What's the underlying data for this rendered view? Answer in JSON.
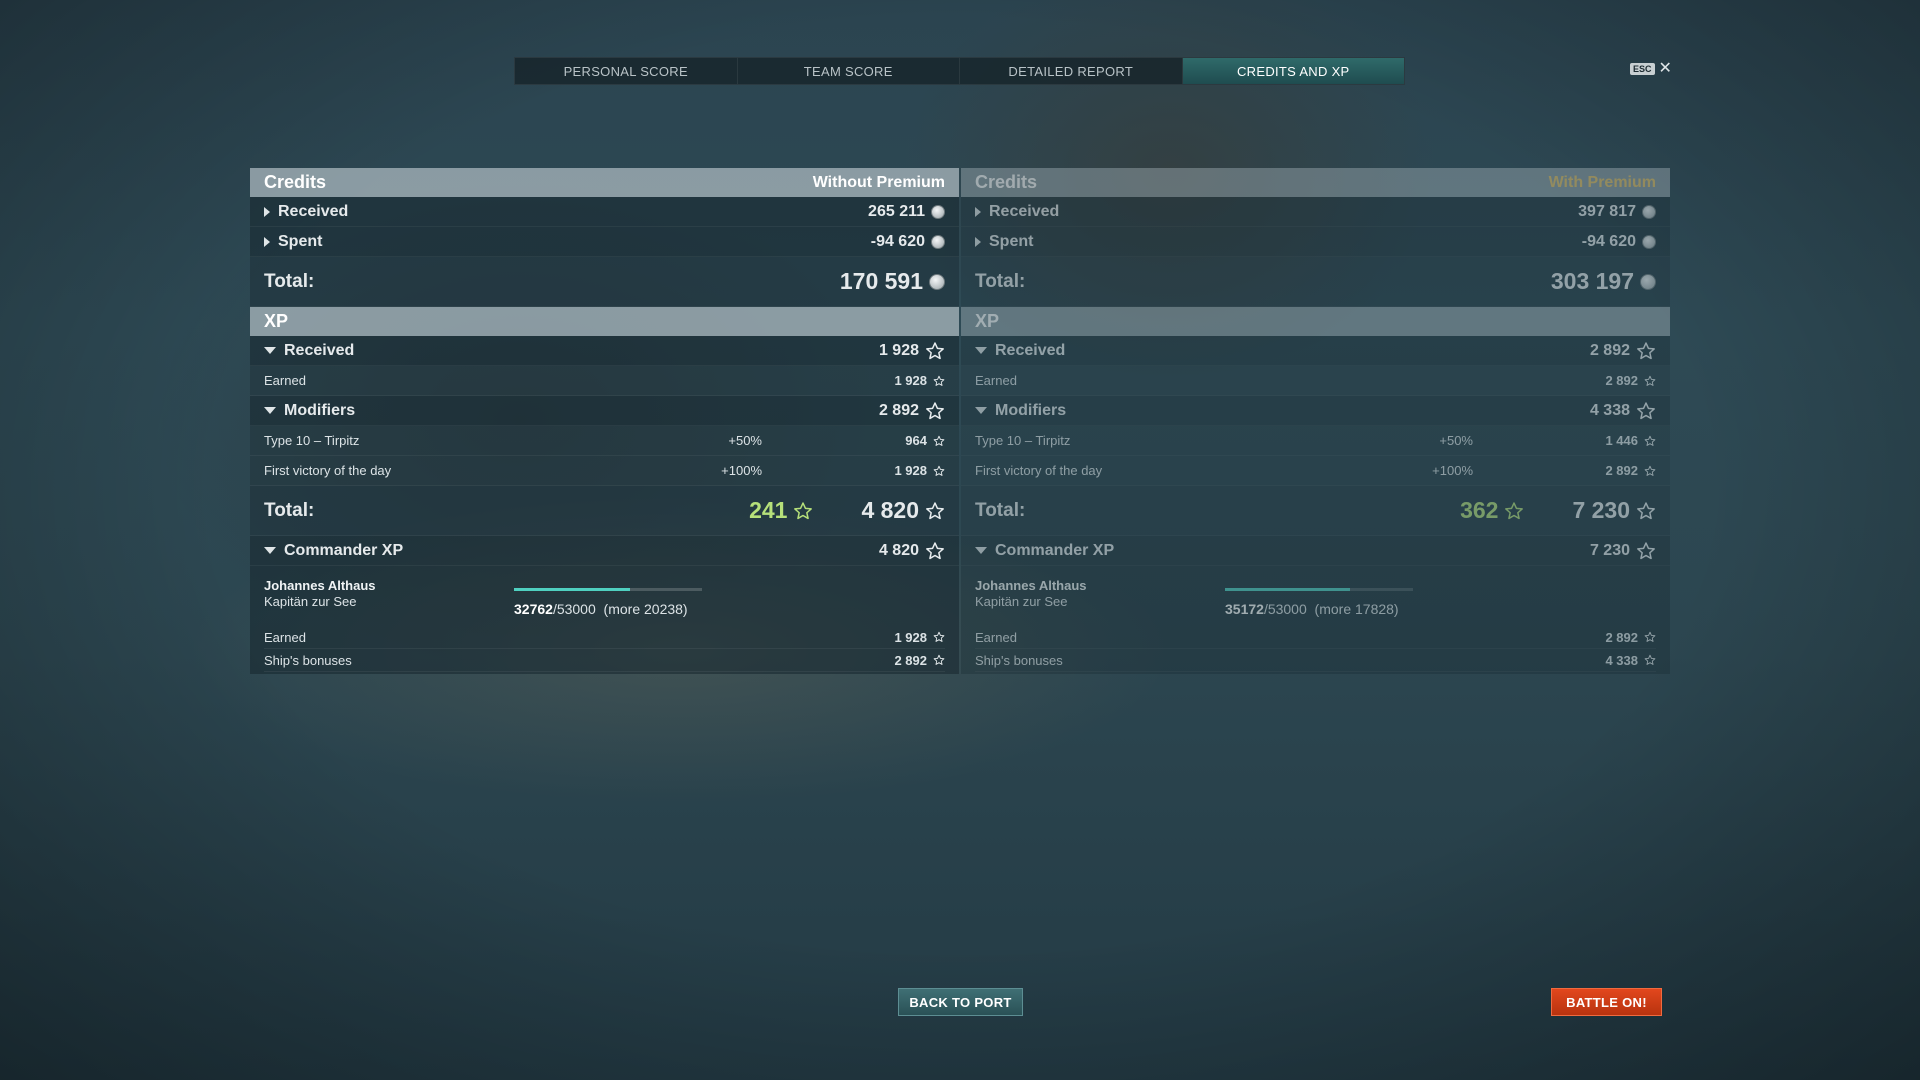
{
  "tabs": [
    "PERSONAL SCORE",
    "TEAM SCORE",
    "DETAILED REPORT",
    "CREDITS AND XP"
  ],
  "esc": {
    "key": "ESC",
    "close_icon": "close-icon"
  },
  "left": {
    "credits_title": "Credits",
    "mode": "Without Premium",
    "received_label": "Received",
    "received": "265 211",
    "spent_label": "Spent",
    "spent": "-94 620",
    "total_label": "Total:",
    "total": "170 591",
    "xp_title": "XP",
    "xp_received_label": "Received",
    "xp_received": "1 928",
    "earned_label": "Earned",
    "earned": "1 928",
    "modifiers_label": "Modifiers",
    "modifiers": "2 892",
    "mod1_label": "Type 10 – Tirpitz",
    "mod1_pct": "+50%",
    "mod1_val": "964",
    "mod2_label": "First victory of the day",
    "mod2_pct": "+100%",
    "mod2_val": "1 928",
    "xp_total_label": "Total:",
    "free_xp": "241",
    "xp_total": "4 820",
    "cmdr_label": "Commander XP",
    "cmdr_xp": "4 820",
    "cmdr_name": "Johannes Althaus",
    "cmdr_rank": "Kapitän zur See",
    "progress_current": "32762",
    "progress_max": "/53000",
    "progress_more": "(more 20238)",
    "progress_fraction": 0.618,
    "cmdr_earned_label": "Earned",
    "cmdr_earned": "1 928",
    "cmdr_bonus_label": "Ship's bonuses",
    "cmdr_bonus": "2 892"
  },
  "right": {
    "credits_title": "Credits",
    "mode": "With Premium",
    "received_label": "Received",
    "received": "397 817",
    "spent_label": "Spent",
    "spent": "-94 620",
    "total_label": "Total:",
    "total": "303 197",
    "xp_title": "XP",
    "xp_received_label": "Received",
    "xp_received": "2 892",
    "earned_label": "Earned",
    "earned": "2 892",
    "modifiers_label": "Modifiers",
    "modifiers": "4 338",
    "mod1_label": "Type 10 – Tirpitz",
    "mod1_pct": "+50%",
    "mod1_val": "1 446",
    "mod2_label": "First victory of the day",
    "mod2_pct": "+100%",
    "mod2_val": "2 892",
    "xp_total_label": "Total:",
    "free_xp": "362",
    "xp_total": "7 230",
    "cmdr_label": "Commander XP",
    "cmdr_xp": "7 230",
    "cmdr_name": "Johannes Althaus",
    "cmdr_rank": "Kapitän zur See",
    "progress_current": "35172",
    "progress_max": "/53000",
    "progress_more": "(more 17828)",
    "progress_fraction": 0.664,
    "cmdr_earned_label": "Earned",
    "cmdr_earned": "2 892",
    "cmdr_bonus_label": "Ship's bonuses",
    "cmdr_bonus": "4 338"
  },
  "buttons": {
    "back_to_port": "BACK TO PORT",
    "battle_on": "BATTLE ON!"
  },
  "colors": {
    "accent_teal": "#2f6a6a",
    "premium_gold": "#e8c46a",
    "free_xp_green": "#b6e07a",
    "battle_orange": "#e2471d"
  }
}
